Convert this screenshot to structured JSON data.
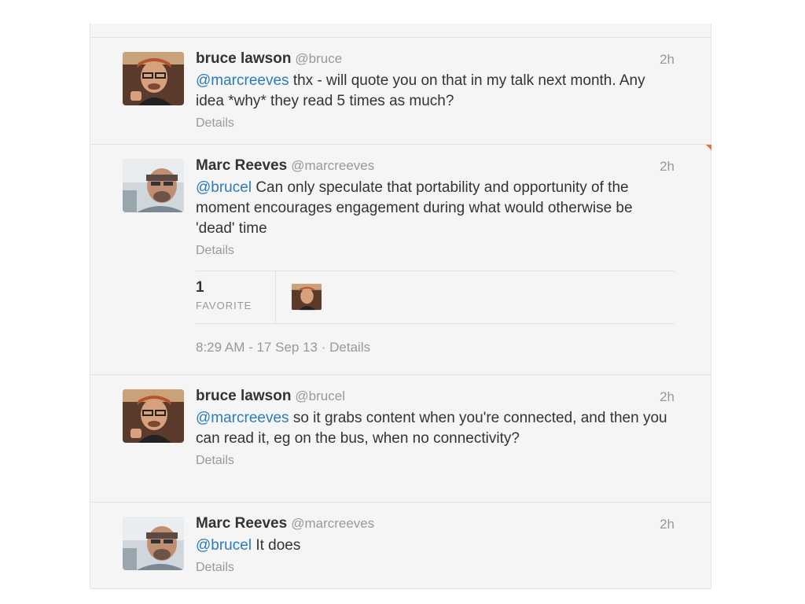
{
  "tweets": [
    {
      "fullname": "bruce lawson",
      "username": "@bruce",
      "time": "2h",
      "mention": "@marcreeves",
      "text": " thx - will quote you on that in my talk next month. Any idea *why* they read 5 times as much?",
      "details": "Details",
      "avatar": "bruce-avatar"
    },
    {
      "fullname": "Marc Reeves",
      "username": "@marcreeves",
      "time": "2h",
      "mention": "@brucel",
      "text": " Can only speculate that portability and opportunity of the moment encourages engagement during what would otherwise be 'dead' time",
      "details": "Details",
      "avatar": "marc-avatar",
      "favorites_count": "1",
      "favorites_label": "FAVORITE",
      "timestamp": "8:29 AM - 17 Sep 13",
      "separator": "·",
      "meta_details": "Details"
    },
    {
      "fullname": "bruce lawson",
      "username": "@brucel",
      "time": "2h",
      "mention": "@marcreeves",
      "text": " so it grabs content when you're connected, and then you can read it, eg on the bus, when no connectivity?",
      "details": "Details",
      "avatar": "bruce-avatar"
    },
    {
      "fullname": "Marc Reeves",
      "username": "@marcreeves",
      "time": "2h",
      "mention": "@brucel",
      "text": " It does",
      "details": "Details",
      "avatar": "marc-avatar"
    }
  ],
  "colors": {
    "mention": "#2b7bb9",
    "muted": "#999999",
    "background": "#f5f5f5",
    "accent_corner": "#e8703a"
  }
}
